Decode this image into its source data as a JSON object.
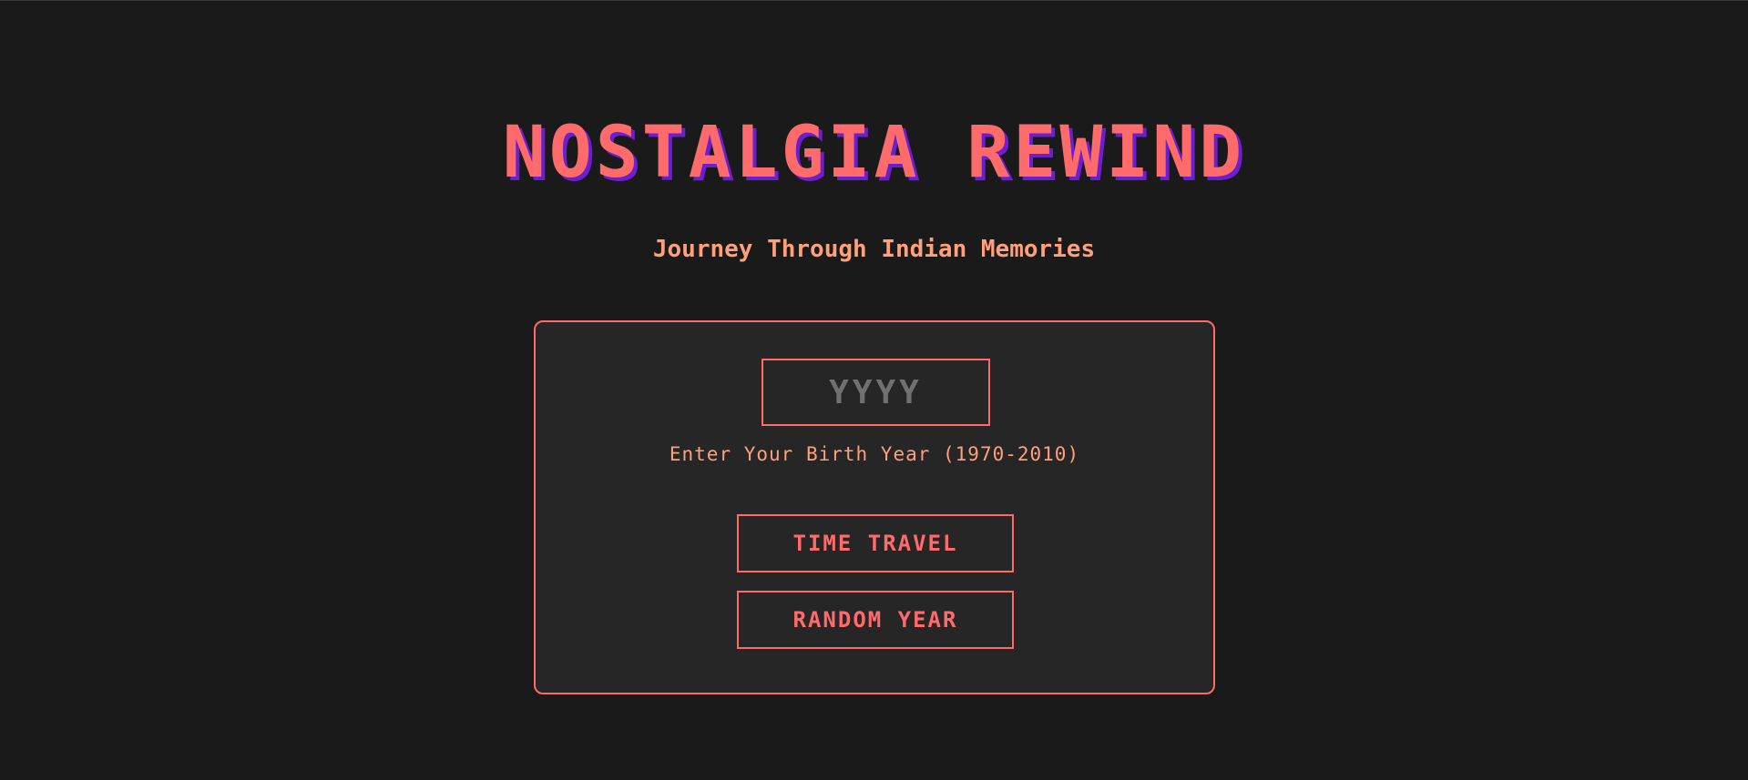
{
  "header": {
    "title": "NOSTALGIA REWIND",
    "subtitle": "Journey Through Indian Memories"
  },
  "form": {
    "year_placeholder": "YYYY",
    "year_value": "",
    "hint": "Enter Your Birth Year (1970-2010)",
    "time_travel_label": "TIME TRAVEL",
    "random_year_label": "RANDOM YEAR"
  },
  "colors": {
    "background": "#1a1a1a",
    "card_background": "#262626",
    "accent": "#ff6b6b",
    "subtitle": "#ffa07a",
    "title_shadow": "#6a1fd0",
    "placeholder": "#707070"
  }
}
